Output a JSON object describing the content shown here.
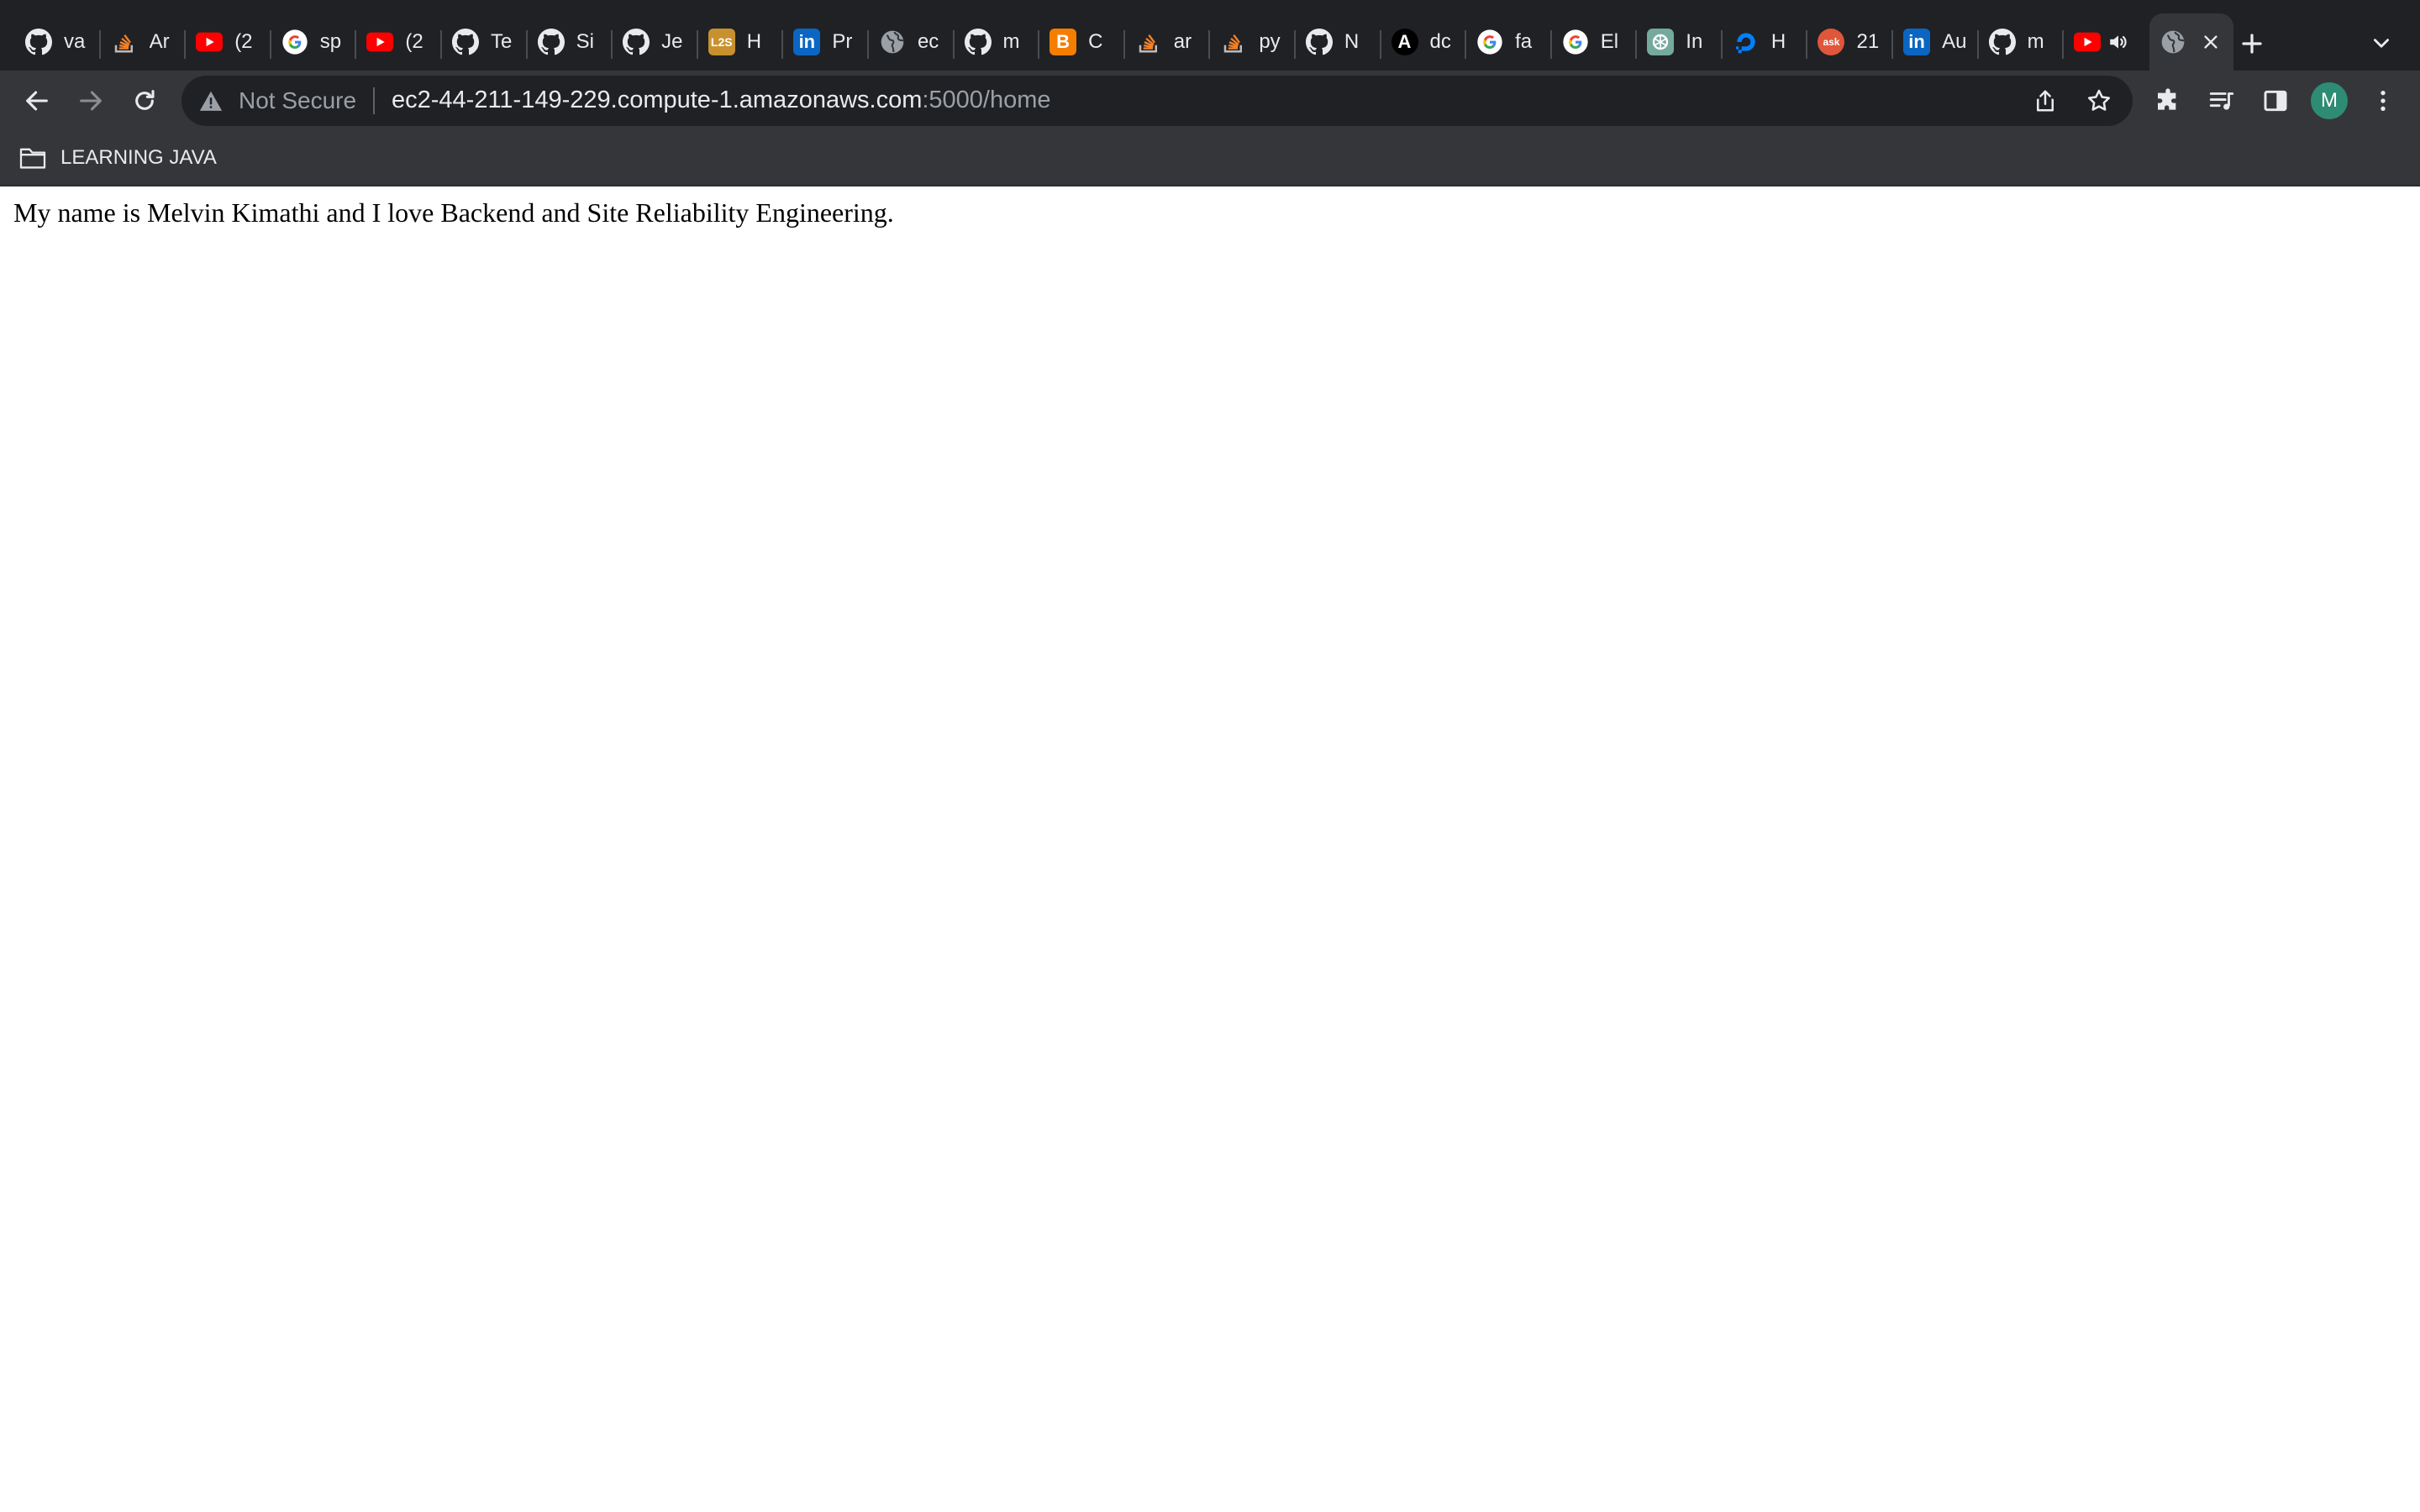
{
  "tabs": [
    {
      "title": "va",
      "favicon": "github-icon"
    },
    {
      "title": "Ar",
      "favicon": "stackoverflow-icon"
    },
    {
      "title": "(2",
      "favicon": "youtube-icon"
    },
    {
      "title": "sp",
      "favicon": "google-icon"
    },
    {
      "title": "(2",
      "favicon": "youtube-icon"
    },
    {
      "title": "Te",
      "favicon": "github-icon"
    },
    {
      "title": "Si",
      "favicon": "github-icon"
    },
    {
      "title": "Je",
      "favicon": "github-icon"
    },
    {
      "title": "H",
      "favicon": "l2s-icon",
      "badge": "L2S"
    },
    {
      "title": "Pr",
      "favicon": "linkedin-icon",
      "badge": "in"
    },
    {
      "title": "ec",
      "favicon": "globe-icon"
    },
    {
      "title": "m",
      "favicon": "github-icon"
    },
    {
      "title": "C",
      "favicon": "blogger-icon",
      "badge": "B"
    },
    {
      "title": "ar",
      "favicon": "stackoverflow-icon"
    },
    {
      "title": "py",
      "favicon": "stackoverflow-icon"
    },
    {
      "title": "N",
      "favicon": "github-icon"
    },
    {
      "title": "dc",
      "favicon": "angular-icon",
      "badge": "A"
    },
    {
      "title": "fa",
      "favicon": "google-icon"
    },
    {
      "title": "El",
      "favicon": "google-icon"
    },
    {
      "title": "In",
      "favicon": "chatgpt-icon"
    },
    {
      "title": "H",
      "favicon": "digitalocean-icon"
    },
    {
      "title": "21",
      "favicon": "askubuntu-icon",
      "badge": "ask"
    },
    {
      "title": "Au",
      "favicon": "linkedin-icon",
      "badge": "in"
    },
    {
      "title": "m",
      "favicon": "github-icon"
    },
    {
      "title": "",
      "favicon": "youtube-icon",
      "audio": true
    },
    {
      "title": "",
      "favicon": "globe-icon",
      "active": true
    }
  ],
  "colors": {
    "tabstrip_bg": "#202124",
    "toolbar_bg": "#35363a",
    "omnibox_bg": "#202124",
    "text_light": "#e8eaed",
    "text_dim": "#9aa0a6",
    "avatar_bg": "#2e8b74",
    "youtube_red": "#ff0000",
    "linkedin_blue": "#0a66c2",
    "stackoverflow_orange": "#f48024",
    "blogger_orange": "#f57d00",
    "l2s_gold": "#c8912e",
    "askubuntu_orange": "#e0563b"
  },
  "address_bar": {
    "security_label": "Not Secure",
    "url_host": "ec2-44-211-149-229.compute-1.amazonaws.com",
    "url_rest": ":5000/home"
  },
  "profile": {
    "initial": "M"
  },
  "bookmarks": [
    {
      "label": "LEARNING JAVA",
      "icon": "folder-icon"
    }
  ],
  "page": {
    "body_text": "My name is Melvin Kimathi and I love Backend and Site Reliability Engineering."
  }
}
